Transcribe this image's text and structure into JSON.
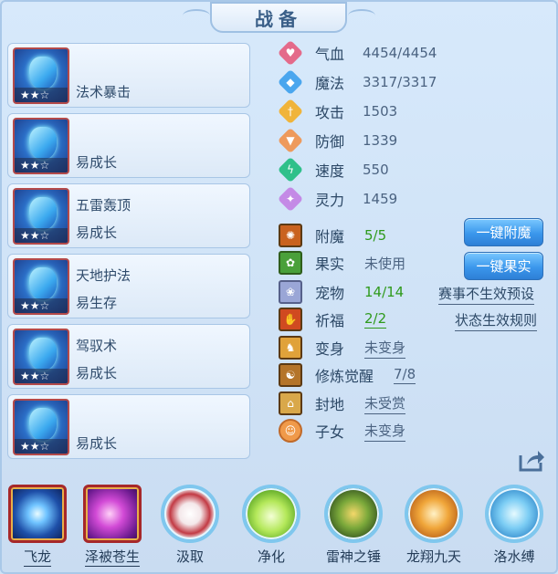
{
  "title": "战备",
  "equipment": [
    {
      "line1": "",
      "line2": "法术暴击",
      "stars": "★★☆"
    },
    {
      "line1": "",
      "line2": "易成长",
      "stars": "★★☆"
    },
    {
      "line1": "五雷轰顶",
      "line2": "易成长",
      "stars": "★★☆"
    },
    {
      "line1": "天地护法",
      "line2": "易生存",
      "stars": "★★☆"
    },
    {
      "line1": "驾驭术",
      "line2": "易成长",
      "stars": "★★☆"
    },
    {
      "line1": "",
      "line2": "易成长",
      "stars": "★★☆"
    }
  ],
  "stats": [
    {
      "label": "气血",
      "value": "4454/4454",
      "icon": "heart-icon",
      "color": "#e46a8a"
    },
    {
      "label": "魔法",
      "value": "3317/3317",
      "icon": "magic-icon",
      "color": "#4aa6ee"
    },
    {
      "label": "攻击",
      "value": "1503",
      "icon": "sword-icon",
      "color": "#f0b43a"
    },
    {
      "label": "防御",
      "value": "1339",
      "icon": "shield-icon",
      "color": "#ee9a5c"
    },
    {
      "label": "速度",
      "value": "550",
      "icon": "lightning-icon",
      "color": "#2fc08a"
    },
    {
      "label": "灵力",
      "value": "1459",
      "icon": "spirit-icon",
      "color": "#c48ae6"
    }
  ],
  "attrs": [
    {
      "label": "附魔",
      "value": "5/5",
      "style": "green",
      "icon": "enchant-icon"
    },
    {
      "label": "果实",
      "value": "未使用",
      "style": "muted",
      "icon": "fruit-icon"
    },
    {
      "label": "宠物",
      "value": "14/14",
      "style": "green",
      "icon": "pet-icon"
    },
    {
      "label": "祈福",
      "value": "2/2",
      "style": "green-u",
      "icon": "pray-icon"
    },
    {
      "label": "变身",
      "value": "未变身",
      "style": "muted-u",
      "icon": "transform-icon"
    },
    {
      "label": "修炼觉醒",
      "value": "7/8",
      "style": "muted-u",
      "icon": "cultivate-icon"
    },
    {
      "label": "封地",
      "value": "未受赏",
      "style": "muted-u",
      "icon": "fief-icon"
    },
    {
      "label": "子女",
      "value": "未变身",
      "style": "muted-u",
      "icon": "child-icon"
    }
  ],
  "buttons": {
    "enchant": "一键附魔",
    "fruit": "一键果实"
  },
  "links": {
    "event_preset": "赛事不生效预设",
    "status_rules": "状态生效规则"
  },
  "skills": [
    {
      "label": "飞龙",
      "shape": "square",
      "underline": true,
      "icon": "flying-dragon-icon"
    },
    {
      "label": "泽被苍生",
      "shape": "square",
      "underline": true,
      "icon": "blessing-hand-icon"
    },
    {
      "label": "汲取",
      "shape": "round",
      "underline": false,
      "icon": "absorb-icon"
    },
    {
      "label": "净化",
      "shape": "round",
      "underline": false,
      "icon": "purify-heart-icon"
    },
    {
      "label": "雷神之锤",
      "shape": "round",
      "underline": false,
      "icon": "thunder-hammer-icon"
    },
    {
      "label": "龙翔九天",
      "shape": "round",
      "underline": false,
      "icon": "dragon-soar-icon"
    },
    {
      "label": "洛水缚",
      "shape": "round",
      "underline": false,
      "icon": "water-bind-icon"
    }
  ],
  "colors": {
    "panel_bg": "#cfe3f6",
    "accent_blue": "#3b97ec",
    "green_value": "#2f9a1c",
    "frame_red": "#a6282a"
  }
}
